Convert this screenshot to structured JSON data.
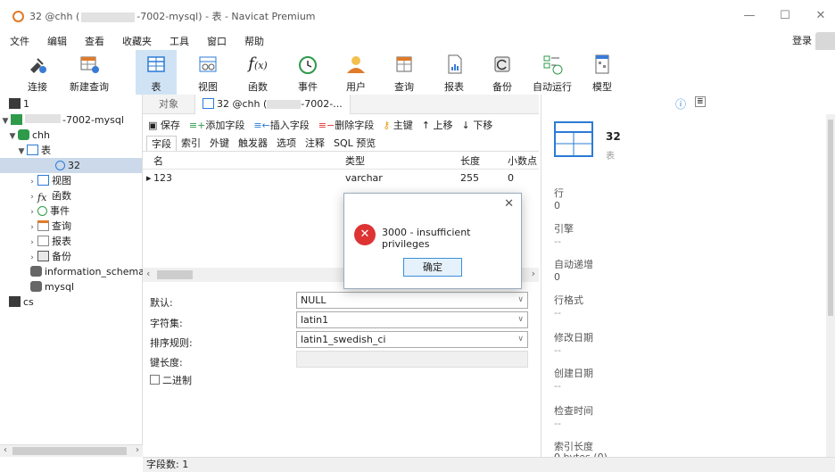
{
  "window": {
    "title_prefix": "32 @chh (",
    "title_suffix": "-7002-mysql) - 表 - Navicat Premium",
    "min": "—",
    "max": "☐",
    "close": "✕"
  },
  "menu": [
    "文件",
    "编辑",
    "查看",
    "收藏夹",
    "工具",
    "窗口",
    "帮助"
  ],
  "login": "登录",
  "toolbar": {
    "connect": "连接",
    "new_query": "新建查询",
    "table": "表",
    "view": "视图",
    "function": "函数",
    "event": "事件",
    "user": "用户",
    "query": "查询",
    "report": "报表",
    "backup": "备份",
    "automation": "自动运行",
    "model": "模型"
  },
  "tree": {
    "n1": "1",
    "conn": "-7002-mysql",
    "db": "chh",
    "tables": "表",
    "table32": "32",
    "views": "视图",
    "functions": "函数",
    "events": "事件",
    "queries": "查询",
    "reports": "报表",
    "backups": "备份",
    "info_schema": "information_schema",
    "mysql": "mysql",
    "cs": "cs"
  },
  "tabs": {
    "objects": "对象",
    "current_prefix": "32 @chh (",
    "current_suffix": "-7002-..."
  },
  "design_toolbar": {
    "save": "保存",
    "add_field": "添加字段",
    "insert_field": "插入字段",
    "delete_field": "删除字段",
    "primary_key": "主键",
    "move_up": "上移",
    "move_down": "下移"
  },
  "subtabs": [
    "字段",
    "索引",
    "外键",
    "触发器",
    "选项",
    "注释",
    "SQL 预览"
  ],
  "grid": {
    "headers": {
      "name": "名",
      "type": "类型",
      "length": "长度",
      "decimals": "小数点"
    },
    "row": {
      "name": "123",
      "type": "varchar",
      "length": "255",
      "decimals": "0"
    }
  },
  "props": {
    "default_label": "默认:",
    "default_value": "NULL",
    "charset_label": "字符集:",
    "charset_value": "latin1",
    "collation_label": "排序规则:",
    "collation_value": "latin1_swedish_ci",
    "keylen_label": "键长度:",
    "binary_label": "二进制"
  },
  "status": "字段数: 1",
  "info_panel": {
    "table_name": "32",
    "table_type": "表",
    "rows_label": "行",
    "rows_value": "0",
    "engine_label": "引擎",
    "engine_value": "--",
    "autoinc_label": "自动递增",
    "autoinc_value": "0",
    "rowformat_label": "行格式",
    "rowformat_value": "--",
    "modified_label": "修改日期",
    "modified_value": "--",
    "created_label": "创建日期",
    "created_value": "--",
    "check_label": "检查时间",
    "check_value": "--",
    "indexlen_label": "索引长度",
    "indexlen_value": "0 bytes (0)"
  },
  "dialog": {
    "message": "3000 - insufficient privileges",
    "ok": "确定",
    "close": "✕"
  }
}
